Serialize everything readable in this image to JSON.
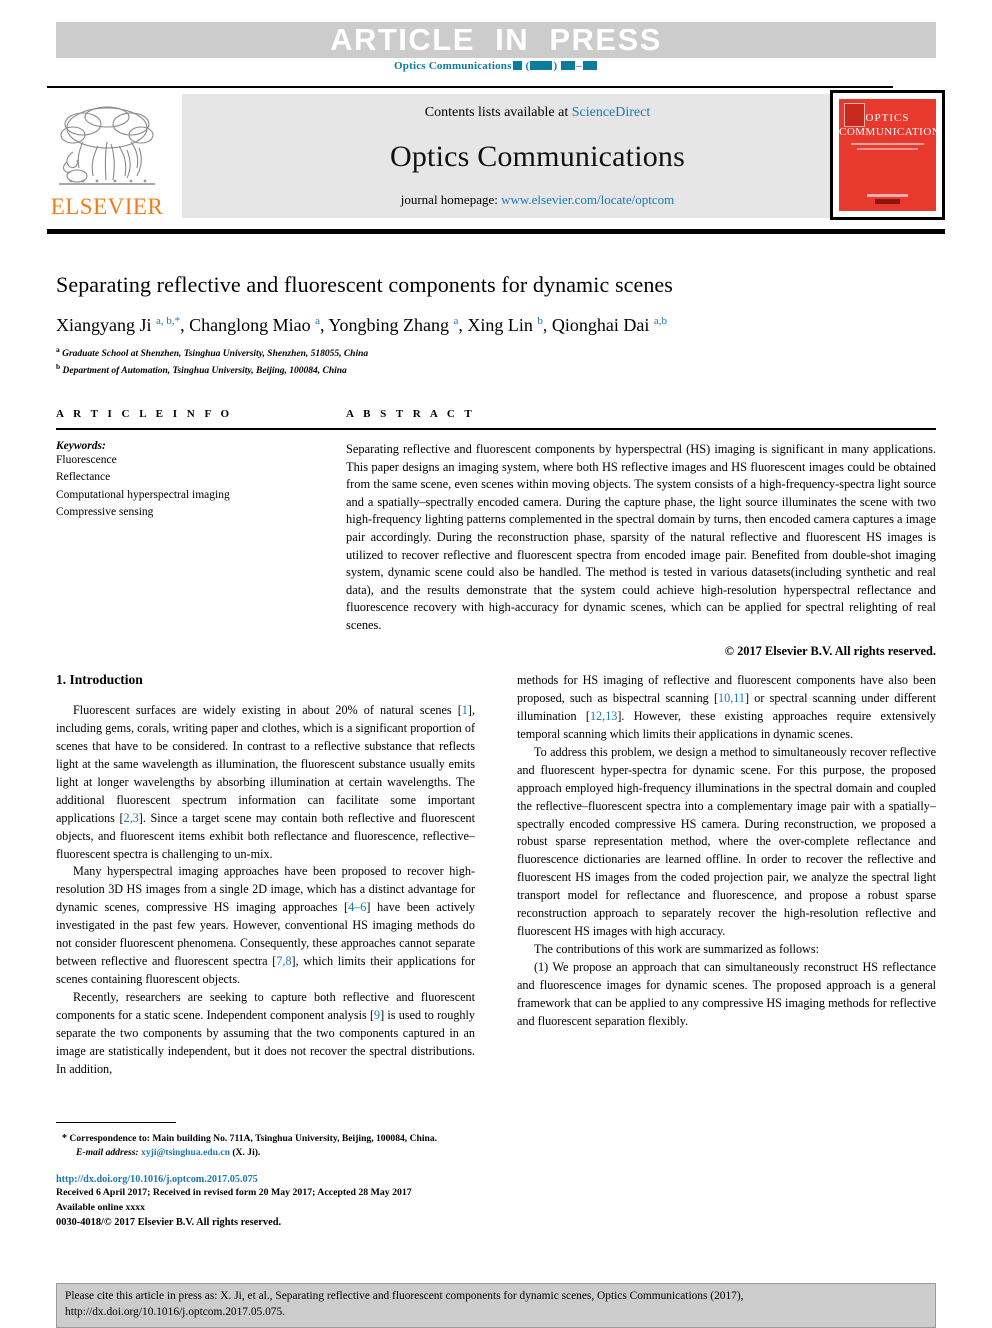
{
  "banner": {
    "article_in_press": "ARTICLE  IN  PRESS",
    "journal_ref_prefix": "Optics Communications"
  },
  "masthead": {
    "contents_prefix": "Contents lists available at ",
    "contents_link": "ScienceDirect",
    "journal_title": "Optics Communications",
    "homepage_prefix": "journal homepage: ",
    "homepage_link": "www.elsevier.com/locate/optcom",
    "publisher_wordmark": "ELSEVIER",
    "cover": {
      "line1": "OPTICS",
      "line2": "COMMUNICATIONS"
    }
  },
  "article": {
    "title": "Separating reflective and fluorescent components for dynamic scenes",
    "authors_html": "Xiangyang Ji <sup class=\"aff\">a, b,</sup><sup class=\"star\">*</sup>, Changlong Miao <sup class=\"aff\">a</sup>, Yongbing Zhang <sup class=\"aff\">a</sup>, Xing Lin <sup class=\"aff\">b</sup>, Qionghai Dai <sup class=\"aff\">a,b</sup>",
    "affiliations": [
      {
        "mark": "a",
        "text": "Graduate School at Shenzhen, Tsinghua University, Shenzhen, 518055, China"
      },
      {
        "mark": "b",
        "text": "Department of Automation, Tsinghua University, Beijing, 100084, China"
      }
    ]
  },
  "article_info": {
    "heading": "A R T I C L E   I N F O",
    "keywords_label": "Keywords:",
    "keywords": [
      "Fluorescence",
      "Reflectance",
      "Computational hyperspectral imaging",
      "Compressive sensing"
    ]
  },
  "abstract": {
    "heading": "A B S T R A C T",
    "text": "Separating reflective and fluorescent components by hyperspectral (HS) imaging is significant in many applications. This paper designs an imaging system, where both HS reflective images and HS fluorescent images could be obtained from the same scene, even scenes within moving objects. The system consists of a high-frequency-spectra light source and a spatially–spectrally encoded camera. During the capture phase, the light source illuminates the scene with two high-frequency lighting patterns complemented in the spectral domain by turns, then encoded camera captures a image pair accordingly. During the reconstruction phase, sparsity of the natural reflective and fluorescent HS images is utilized to recover reflective and fluorescent spectra from encoded image pair. Benefited from double-shot imaging system, dynamic scene could also be handled. The method is tested in various datasets(including synthetic and real data), and the results demonstrate that the system could achieve high-resolution hyperspectral reflectance and fluorescence recovery with high-accuracy for dynamic scenes, which can be applied for spectral relighting of real scenes.",
    "copyright": "© 2017 Elsevier B.V. All rights reserved."
  },
  "body": {
    "section_heading": "1. Introduction",
    "left_paragraphs": [
      "Fluorescent surfaces are widely existing in about 20% of natural scenes [1], including gems, corals, writing paper and clothes, which is a significant proportion of scenes that have to be considered. In contrast to a reflective substance that reflects light at the same wavelength as illumination, the fluorescent substance usually emits light at longer wavelengths by absorbing illumination at certain wavelengths. The additional fluorescent spectrum information can facilitate some important applications [2,3]. Since a target scene may contain both reflective and fluorescent objects, and fluorescent items exhibit both reflectance and fluorescence, reflective–fluorescent spectra is challenging to un-mix.",
      "Many hyperspectral imaging approaches have been proposed to recover high-resolution 3D HS images from a single 2D image, which has a distinct advantage for dynamic scenes, compressive HS imaging approaches [4–6] have been actively investigated in the past few years. However, conventional HS imaging methods do not consider fluorescent phenomena. Consequently, these approaches cannot separate between reflective and fluorescent spectra [7,8], which limits their applications for scenes containing fluorescent objects.",
      "Recently, researchers are seeking to capture both reflective and fluorescent components for a static scene. Independent component analysis [9] is used to roughly separate the two components by assuming that the two components captured in an image are statistically independent, but it does not recover the spectral distributions. In addition,"
    ],
    "right_paragraphs": [
      "methods for HS imaging of reflective and fluorescent components have also been proposed, such as bispectral scanning [10,11] or spectral scanning under different illumination [12,13]. However, these existing approaches require extensively temporal scanning which limits their applications in dynamic scenes.",
      "To address this problem, we design a method to simultaneously recover reflective and fluorescent hyper-spectra for dynamic scene. For this purpose, the proposed approach employed high-frequency illuminations in the spectral domain and coupled the reflective–fluorescent spectra into a complementary image pair with a spatially–spectrally encoded compressive HS camera. During reconstruction, we proposed a robust sparse representation method, where the over-complete reflectance and fluorescence dictionaries are learned offline. In order to recover the reflective and fluorescent HS images from the coded projection pair, we analyze the spectral light transport model for reflectance and fluorescence, and propose a robust sparse reconstruction approach to separately recover the high-resolution reflective and fluorescent HS images with high accuracy.",
      "The contributions of this work are summarized as follows:",
      "(1) We propose an approach that can simultaneously reconstruct HS reflectance and fluorescence images for dynamic scenes. The proposed approach is a general framework that can be applied to any compressive HS imaging methods for reflective and fluorescent separation flexibly."
    ]
  },
  "footnotes": {
    "correspondence": "Correspondence to: Main building No. 711A, Tsinghua University, Beijing, 100084, China.",
    "email_label": "E-mail address:",
    "email": "xyji@tsinghua.edu.cn",
    "email_suffix": "(X. Ji).",
    "doi": "http://dx.doi.org/10.1016/j.optcom.2017.05.075",
    "dates": "Received 6 April 2017; Received in revised form 20 May 2017; Accepted 28 May 2017",
    "available": "Available online xxxx",
    "issn": "0030-4018/© 2017 Elsevier B.V. All rights reserved."
  },
  "cite_footer": {
    "line1": "Please cite this article in press as: X. Ji, et al., Separating reflective and fluorescent components for dynamic scenes, Optics Communications (2017),",
    "line2": "http://dx.doi.org/10.1016/j.optcom.2017.05.075."
  },
  "colors": {
    "link": "#1a78b4",
    "journal_ref": "#0b7c9b",
    "elsevier_orange": "#ef7d1a",
    "banner_gray": "#cccccc",
    "panel_gray": "#e6e6e6",
    "cover_red": "#e8392e"
  }
}
